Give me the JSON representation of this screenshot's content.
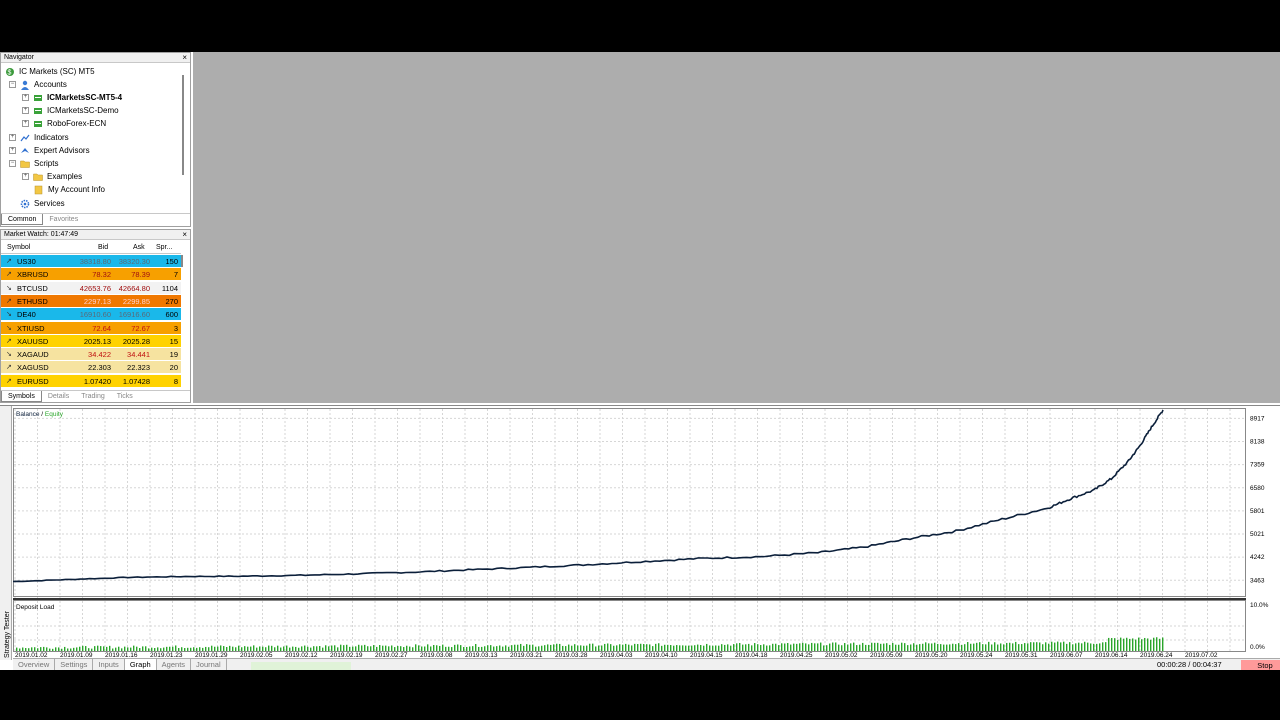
{
  "navigator": {
    "title": "Navigator",
    "root": "IC Markets (SC) MT5",
    "accounts": "Accounts",
    "account_items": [
      "ICMarketsSC-MT5-4",
      "ICMarketsSC-Demo",
      "RoboForex-ECN"
    ],
    "indicators": "Indicators",
    "experts": "Expert Advisors",
    "scripts": "Scripts",
    "examples": "Examples",
    "my_account_info": "My Account Info",
    "services": "Services",
    "tabs": [
      "Common",
      "Favorites"
    ]
  },
  "market_watch": {
    "title": "Market Watch: 01:47:49",
    "headers": {
      "symbol": "Symbol",
      "bid": "Bid",
      "ask": "Ask",
      "spread": "Spr..."
    },
    "rows": [
      {
        "symbol": "US30",
        "bid": "38318.80",
        "ask": "38320.30",
        "spread": "150",
        "bg": "#1ab8ea",
        "fg": "#5a6a78",
        "arrow": "up"
      },
      {
        "symbol": "XBRUSD",
        "bid": "78.32",
        "ask": "78.39",
        "spread": "7",
        "bg": "#f7a000",
        "fg": "#a01010",
        "arrow": "up"
      },
      {
        "symbol": "BTCUSD",
        "bid": "42653.76",
        "ask": "42664.80",
        "spread": "1104",
        "bg": "#f2f2f2",
        "fg": "#a01010",
        "arrow": "down"
      },
      {
        "symbol": "ETHUSD",
        "bid": "2297.13",
        "ask": "2299.85",
        "spread": "270",
        "bg": "#f07800",
        "fg": "#ffd0d0",
        "arrow": "up"
      },
      {
        "symbol": "DE40",
        "bid": "16910.60",
        "ask": "16916.60",
        "spread": "600",
        "bg": "#1ab8ea",
        "fg": "#5a6a78",
        "arrow": "down"
      },
      {
        "symbol": "XTIUSD",
        "bid": "72.64",
        "ask": "72.67",
        "spread": "3",
        "bg": "#f7a000",
        "fg": "#c01010",
        "arrow": "down"
      },
      {
        "symbol": "XAUUSD",
        "bid": "2025.13",
        "ask": "2025.28",
        "spread": "15",
        "bg": "#ffd200",
        "fg": "#000000",
        "arrow": "up"
      },
      {
        "symbol": "XAGAUD",
        "bid": "34.422",
        "ask": "34.441",
        "spread": "19",
        "bg": "#f6e3a0",
        "fg": "#c01010",
        "arrow": "down"
      },
      {
        "symbol": "XAGUSD",
        "bid": "22.303",
        "ask": "22.323",
        "spread": "20",
        "bg": "#f6e3a0",
        "fg": "#000000",
        "arrow": "up"
      },
      {
        "symbol": "EURUSD",
        "bid": "1.07420",
        "ask": "1.07428",
        "spread": "8",
        "bg": "#ffd200",
        "fg": "#000000",
        "arrow": "up"
      }
    ],
    "tabs": [
      "Symbols",
      "Details",
      "Trading",
      "Ticks"
    ]
  },
  "tester": {
    "side_label": "Strategy Tester",
    "legend_balance": "Balance",
    "legend_sep": " / ",
    "legend_equity": "Equity",
    "deposit_label": "Deposit Load",
    "tabs": [
      "Overview",
      "Settings",
      "Inputs",
      "Graph",
      "Agents",
      "Journal"
    ],
    "active_tab": "Graph",
    "time_text": "00:00:28 / 00:04:37",
    "stop_label": "Stop"
  },
  "chart_data": {
    "type": "line",
    "balance_ticks": [
      8917,
      8138,
      7359,
      6580,
      5801,
      5021,
      4242,
      3463
    ],
    "balance_ylim": [
      3000,
      9200
    ],
    "deposit_ticks": [
      "10.0%",
      "0.0%"
    ],
    "x_labels": [
      "2019.01.02",
      "2019.01.09",
      "2019.01.16",
      "2019.01.23",
      "2019.01.29",
      "2019.02.05",
      "2019.02.12",
      "2019.02.19",
      "2019.02.27",
      "2019.03.08",
      "2019.03.13",
      "2019.03.21",
      "2019.03.28",
      "2019.04.03",
      "2019.04.10",
      "2019.04.15",
      "2019.04.18",
      "2019.04.25",
      "2019.05.02",
      "2019.05.09",
      "2019.05.20",
      "2019.05.24",
      "2019.05.31",
      "2019.06.07",
      "2019.06.14",
      "2019.06.24",
      "2019.07.02"
    ],
    "balance_path": [
      [
        0,
        3420
      ],
      [
        0.05,
        3490
      ],
      [
        0.1,
        3560
      ],
      [
        0.15,
        3590
      ],
      [
        0.2,
        3600
      ],
      [
        0.25,
        3630
      ],
      [
        0.3,
        3680
      ],
      [
        0.35,
        3740
      ],
      [
        0.4,
        3820
      ],
      [
        0.45,
        3900
      ],
      [
        0.5,
        3990
      ],
      [
        0.55,
        4100
      ],
      [
        0.6,
        4200
      ],
      [
        0.65,
        4260
      ],
      [
        0.7,
        4390
      ],
      [
        0.74,
        4580
      ],
      [
        0.78,
        4870
      ],
      [
        0.82,
        5120
      ],
      [
        0.86,
        5520
      ],
      [
        0.9,
        5900
      ],
      [
        0.92,
        6220
      ],
      [
        0.94,
        6500
      ],
      [
        0.955,
        6880
      ],
      [
        0.97,
        7480
      ],
      [
        0.98,
        8000
      ],
      [
        0.99,
        8620
      ],
      [
        1.0,
        9200
      ]
    ],
    "colors": {
      "balance": "#0b1f3a",
      "equity": "#2aa52a",
      "grid": "#d6d6d6"
    }
  }
}
